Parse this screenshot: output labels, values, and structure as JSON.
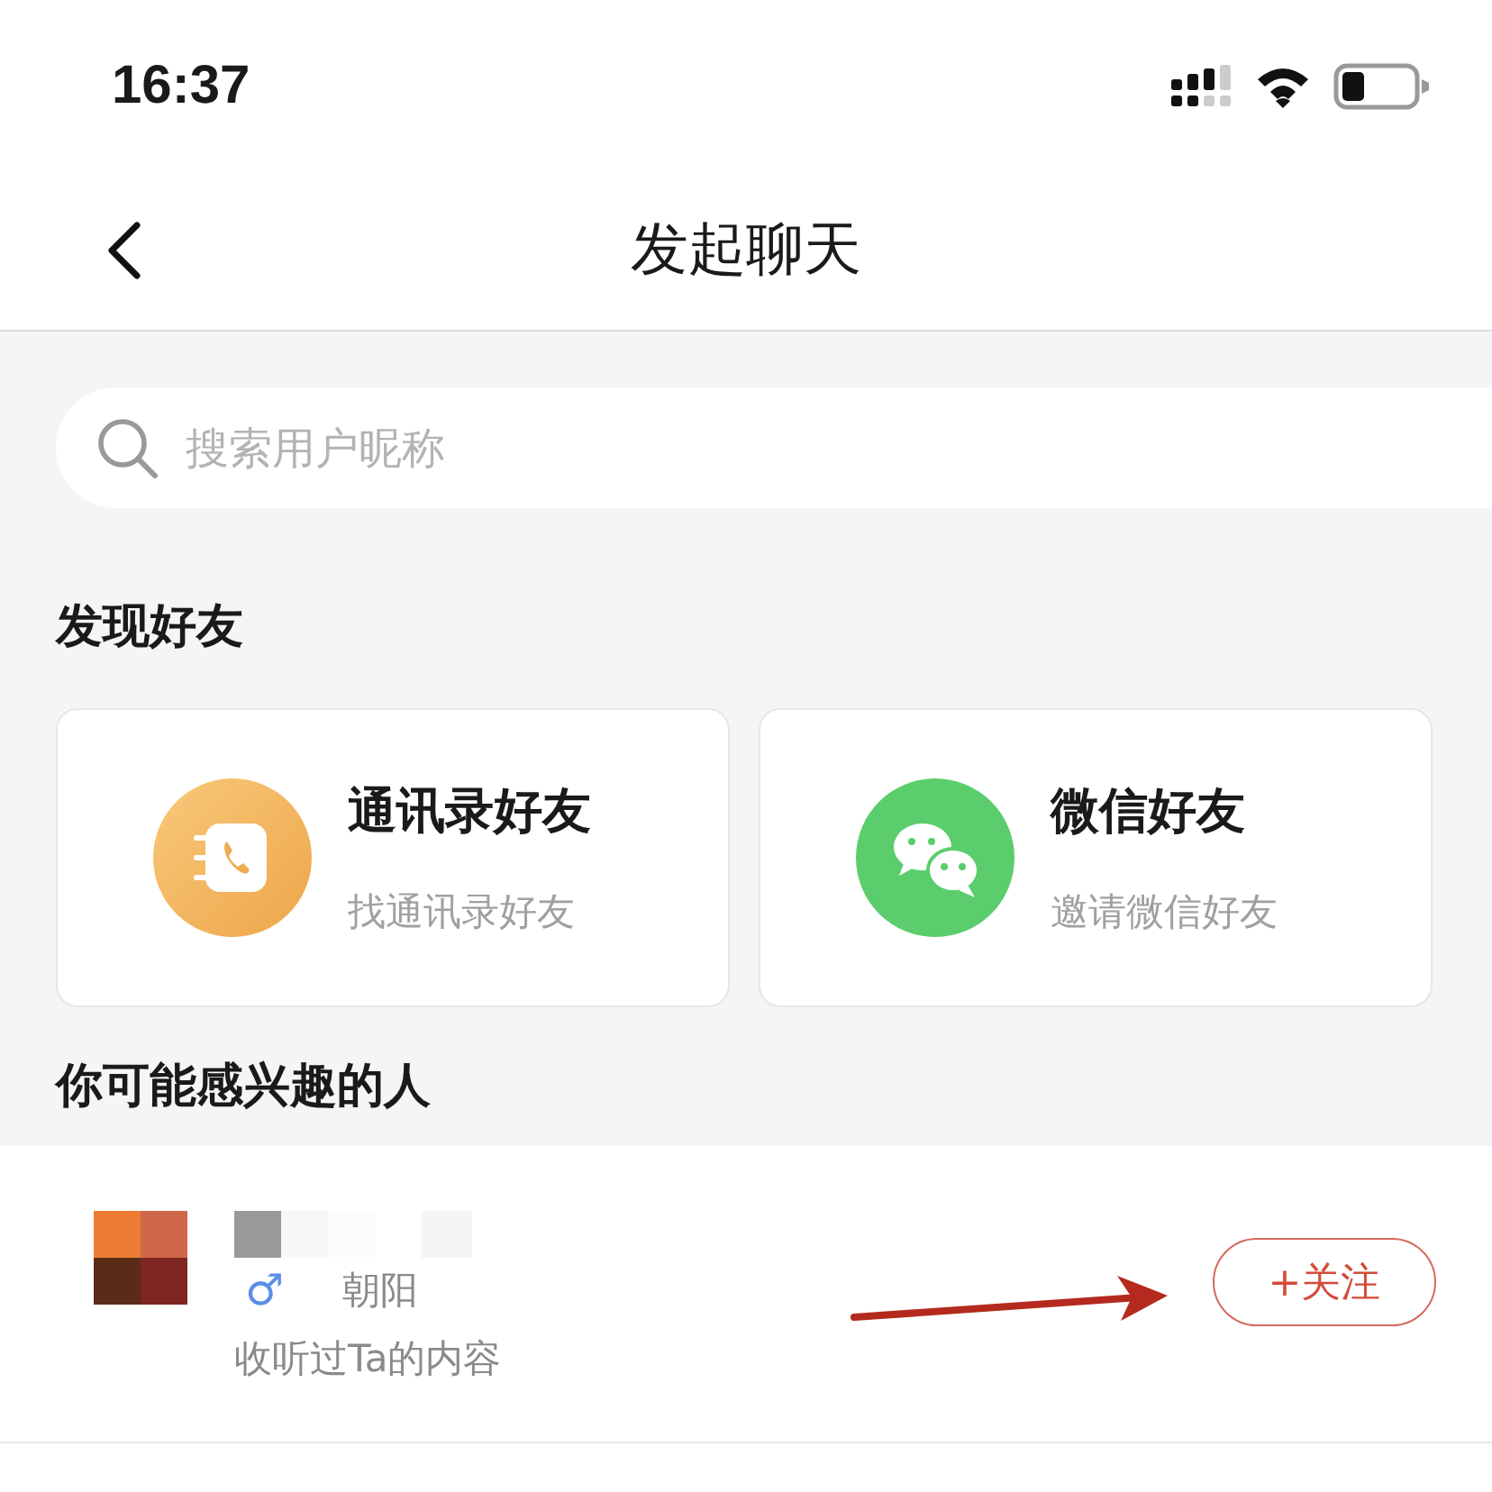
{
  "status_bar": {
    "time": "16:37"
  },
  "nav": {
    "title": "发起聊天"
  },
  "search": {
    "placeholder": "搜索用户昵称"
  },
  "discover": {
    "title": "发现好友",
    "cards": [
      {
        "kind": "contacts",
        "title": "通讯录好友",
        "subtitle": "找通讯录好友"
      },
      {
        "kind": "wechat",
        "title": "微信好友",
        "subtitle": "邀请微信好友"
      }
    ]
  },
  "suggest": {
    "title": "你可能感兴趣的人",
    "people": [
      {
        "gender": "♂",
        "location": "朝阳",
        "note": "收听过Ta的内容",
        "follow": "+关注"
      }
    ]
  }
}
